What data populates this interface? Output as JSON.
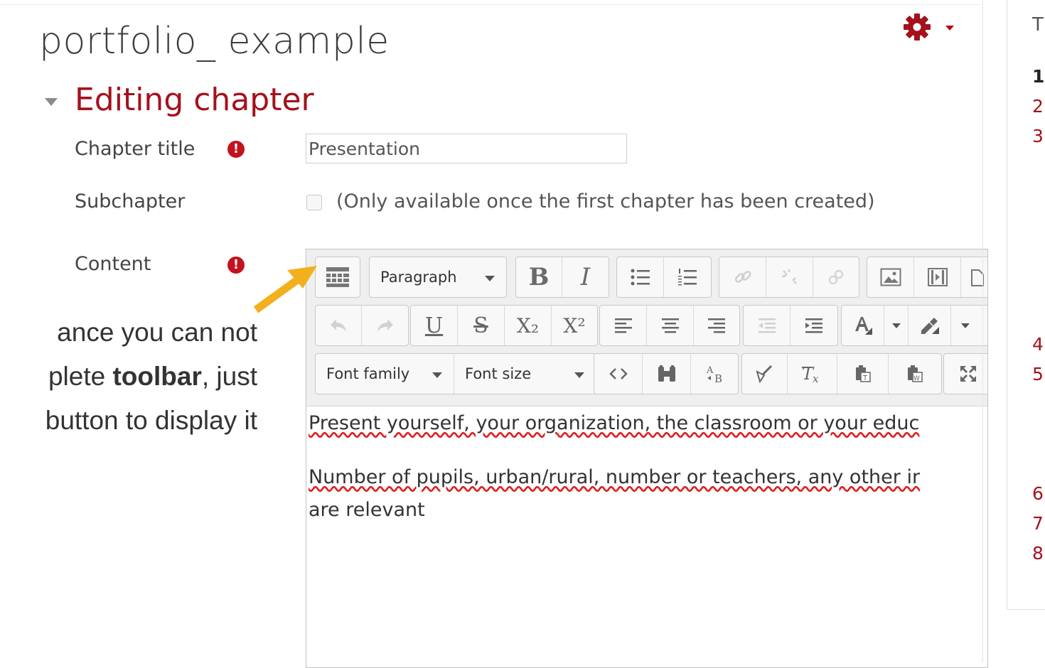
{
  "header": {
    "title": "portfolio_ example"
  },
  "section": {
    "title": "Editing chapter"
  },
  "form": {
    "chapter_title_label": "Chapter title",
    "chapter_title_value": "Presentation",
    "subchapter_label": "Subchapter",
    "subchapter_note": "(Only available once the first chapter has been created)",
    "content_label": "Content",
    "required_mark": "!"
  },
  "toolbar": {
    "paragraph_select": "Paragraph",
    "font_family_select": "Font family",
    "font_size_select": "Font size",
    "bold": "B",
    "italic": "I",
    "underline": "U",
    "strike": "S",
    "subscript": "X₂",
    "superscript": "X²"
  },
  "editor_content": {
    "paragraph1": "Present yourself, your organization, the classroom or your educ",
    "paragraph2_line1": "Number of pupils, urban/rural, number or teachers, any other ir",
    "paragraph2_line2": "are relevant"
  },
  "annotation": {
    "line1": "ance you can not",
    "line2_pre": "plete ",
    "line2_bold": "toolbar",
    "line2_post": ", just",
    "line3": "button to display it"
  },
  "toc": {
    "header": "T",
    "items": [
      "1",
      "2",
      "3",
      "4",
      "5",
      "6",
      "7",
      "8"
    ]
  },
  "colors": {
    "accent": "#a5111c",
    "arrow": "#f2b01e"
  }
}
